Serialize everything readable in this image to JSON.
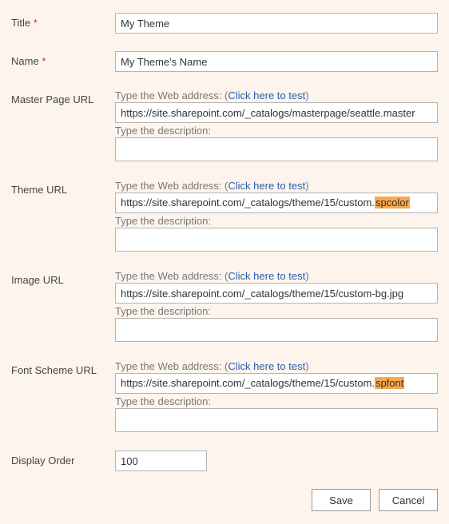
{
  "labels": {
    "title": "Title",
    "name": "Name",
    "master": "Master Page URL",
    "theme": "Theme URL",
    "image": "Image URL",
    "font": "Font Scheme URL",
    "order": "Display Order",
    "req": "*"
  },
  "hints": {
    "addr_prefix": "Type the Web address: (",
    "addr_link": "Click here to test",
    "addr_suffix": ")",
    "desc": "Type the description:"
  },
  "values": {
    "title": "My Theme",
    "name": "My Theme's Name",
    "master_url": "https://site.sharepoint.com/_catalogs/masterpage/seattle.master",
    "master_desc": "",
    "theme_url_pre": "https://site.sharepoint.com/_catalogs/theme/15/custom.",
    "theme_url_hl": "spcolor",
    "theme_url_full": "https://site.sharepoint.com/_catalogs/theme/15/custom.spcolor",
    "theme_desc": "",
    "image_url": "https://site.sharepoint.com/_catalogs/theme/15/custom-bg.jpg",
    "image_desc": "",
    "font_url_pre": "https://site.sharepoint.com/_catalogs/theme/15/custom.",
    "font_url_hl": "spfont",
    "font_url_full": "https://site.sharepoint.com/_catalogs/theme/15/custom.spfont",
    "font_desc": "",
    "order": "100"
  },
  "buttons": {
    "save": "Save",
    "cancel": "Cancel"
  }
}
